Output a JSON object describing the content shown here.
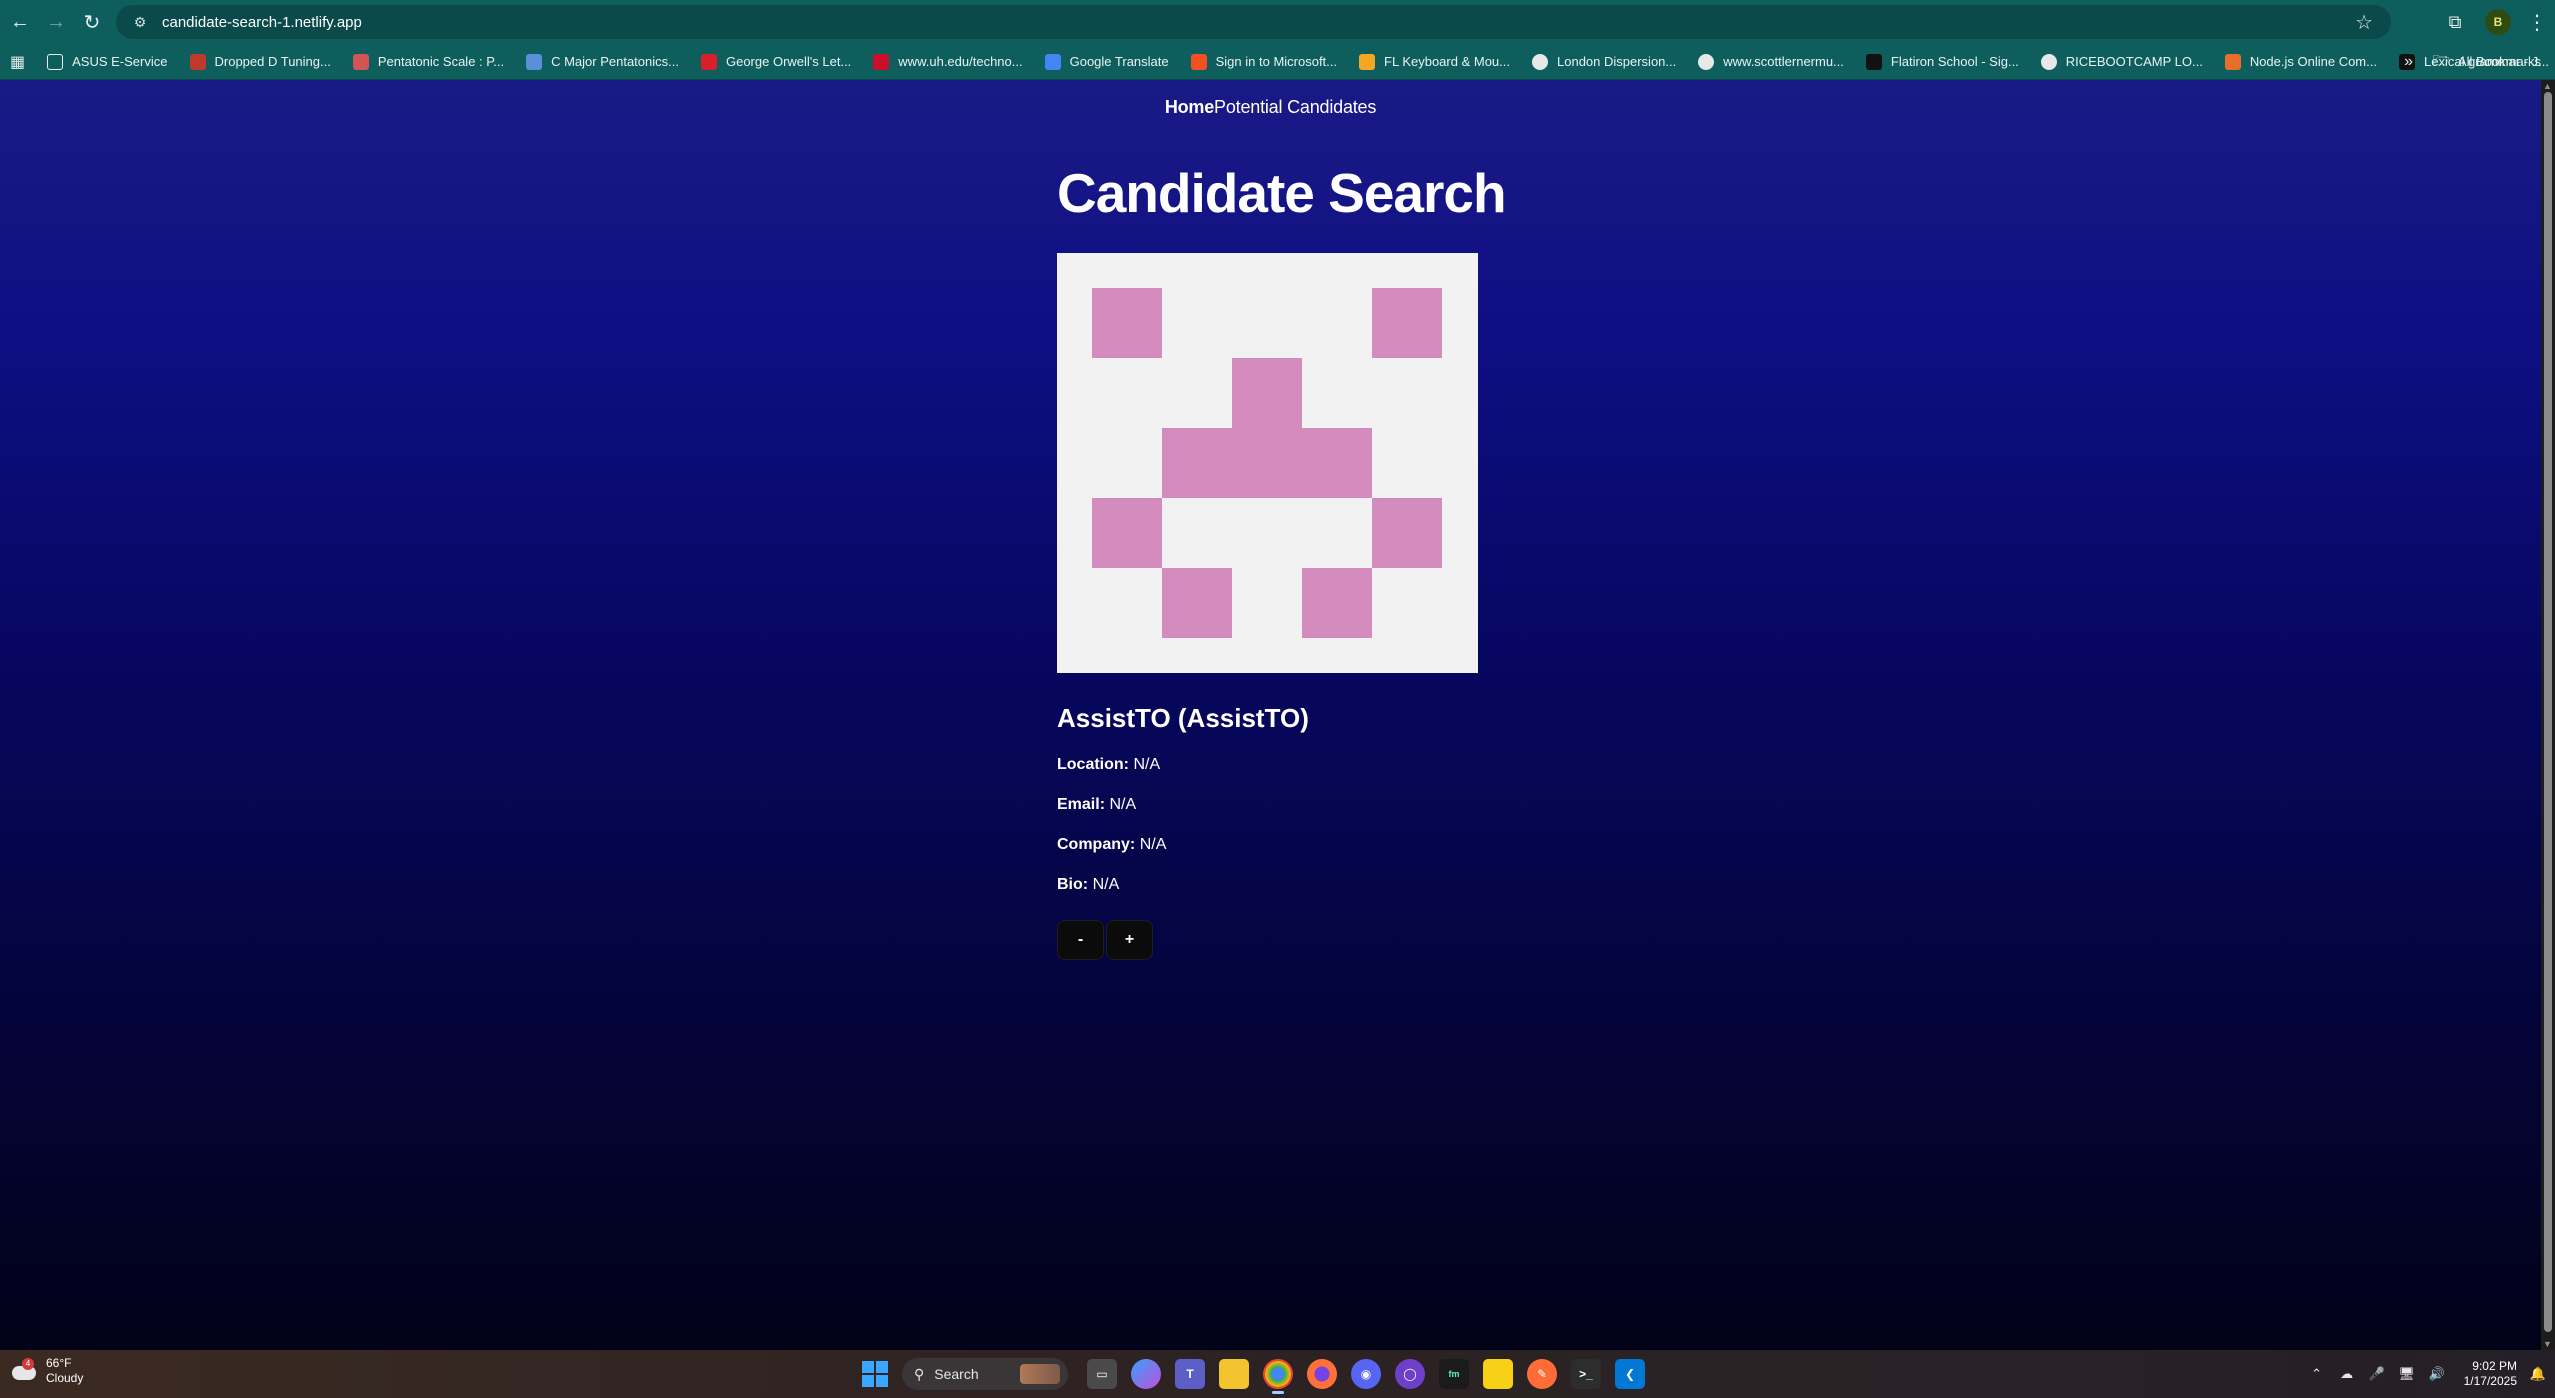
{
  "browser": {
    "url": "candidate-search-1.netlify.app",
    "bookmarks": [
      {
        "label": "ASUS E-Service",
        "icon": "folder-icon",
        "color": "#0f5e5e"
      },
      {
        "label": "Dropped D Tuning...",
        "icon": "guitar-icon",
        "color": "#c0392b"
      },
      {
        "label": "Pentatonic Scale : P...",
        "icon": "guitar-pick-icon",
        "color": "#d35454"
      },
      {
        "label": "C Major Pentatonics...",
        "icon": "music-icon",
        "color": "#5b8fd8"
      },
      {
        "label": "George Orwell's Let...",
        "icon": "book-icon",
        "color": "#d8202a"
      },
      {
        "label": "www.uh.edu/techno...",
        "icon": "uh-logo-icon",
        "color": "#c8102e"
      },
      {
        "label": "Google Translate",
        "icon": "translate-icon",
        "color": "#4285f4"
      },
      {
        "label": "Sign in to Microsoft...",
        "icon": "microsoft-icon",
        "color": "#f25022"
      },
      {
        "label": "FL Keyboard & Mou...",
        "icon": "fl-studio-icon",
        "color": "#f5a623"
      },
      {
        "label": "London Dispersion...",
        "icon": "globe-icon",
        "color": "#ffffff"
      },
      {
        "label": "www.scottlernermu...",
        "icon": "globe-icon",
        "color": "#ffffff"
      },
      {
        "label": "Flatiron School - Sig...",
        "icon": "flatiron-icon",
        "color": "#111111"
      },
      {
        "label": "RICEBOOTCAMP LO...",
        "icon": "globe-icon",
        "color": "#ffffff"
      },
      {
        "label": "Node.js Online Com...",
        "icon": "code-icon",
        "color": "#e76f2a"
      },
      {
        "label": "Lexical grammar - J...",
        "icon": "mdn-icon",
        "color": "#111111"
      }
    ],
    "all_bookmarks_label": "All Bookmarks",
    "profile_initial": "B"
  },
  "site": {
    "nav": {
      "home": "Home",
      "potential": "Potential Candidates"
    },
    "title": "Candidate Search",
    "candidate": {
      "name": "AssistTO (AssistTO)",
      "fields": [
        {
          "label": "Location:",
          "value": "N/A"
        },
        {
          "label": "Email:",
          "value": "N/A"
        },
        {
          "label": "Company:",
          "value": "N/A"
        },
        {
          "label": "Bio:",
          "value": "N/A"
        }
      ]
    },
    "buttons": {
      "reject": "-",
      "accept": "+"
    },
    "avatar_color": "#d48bbd"
  },
  "taskbar": {
    "weather": {
      "temp": "66°F",
      "condition": "Cloudy",
      "badge": "4"
    },
    "search_label": "Search",
    "time": "9:02 PM",
    "date": "1/17/2025"
  }
}
